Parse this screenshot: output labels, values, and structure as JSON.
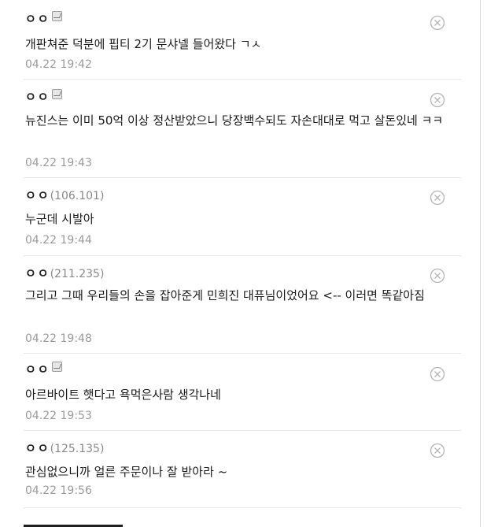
{
  "comments": [
    {
      "author": "ㅇㅇ",
      "ip": "",
      "has_badge": true,
      "text": "개판쳐준 덕분에 핍티 2기 문샤넬 들어왔다 ㄱㅅ",
      "time": "04.22 19:42"
    },
    {
      "author": "ㅇㅇ",
      "ip": "",
      "has_badge": true,
      "text": "뉴진스는 이미 50억 이상 정산받았으니 당장백수되도 자손대대로 먹고 살돈있네 ㅋㅋ",
      "time": "04.22 19:43"
    },
    {
      "author": "ㅇㅇ",
      "ip": "(106.101)",
      "has_badge": false,
      "text": "누군데 시발아",
      "time": "04.22 19:44"
    },
    {
      "author": "ㅇㅇ",
      "ip": "(211.235)",
      "has_badge": false,
      "text": "그리고 그때 우리들의 손을 잡아준게 민희진 대퓨님이었어요 <-- 이러면 똑같아짐",
      "time": "04.22 19:48"
    },
    {
      "author": "ㅇㅇ",
      "ip": "",
      "has_badge": true,
      "text": "아르바이트 햇다고 욕먹은사람 생각나네",
      "time": "04.22 19:53"
    },
    {
      "author": "ㅇㅇ",
      "ip": "(125.135)",
      "has_badge": false,
      "text": "관심없으니까 얼른 주문이나 잘 받아라 ~",
      "time": "04.22 19:56"
    }
  ],
  "colors": {
    "text": "#1a1a1a",
    "meta": "#9a9a9a",
    "divider": "#e8e8e8"
  }
}
